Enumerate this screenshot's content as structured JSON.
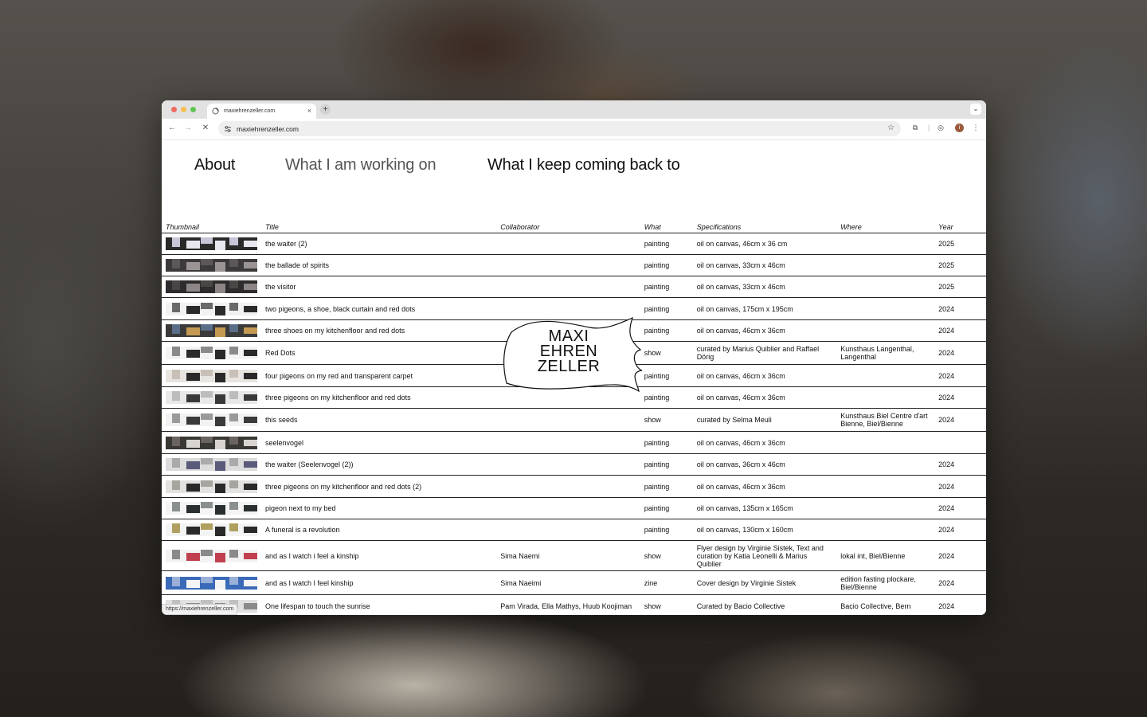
{
  "browser": {
    "tab_title": "maxiehrenzeller.com",
    "new_tab_label": "+",
    "tab_close_label": "×",
    "address": "maxiehrenzeller.com",
    "status_url": "https://maxiehrenzeller.com",
    "profile_initial": "i"
  },
  "nav": {
    "about": "About",
    "working_on": "What I am working on",
    "coming_back": "What I keep coming back to"
  },
  "logo": {
    "line1": "MAXI",
    "line2": "EHREN",
    "line3": "ZELLER"
  },
  "table": {
    "headers": [
      "Thumbnail",
      "Title",
      "Collaborator",
      "What",
      "Specifications",
      "Where",
      "Year"
    ],
    "rows": [
      {
        "title": "the waiter (2)",
        "collaborator": "",
        "what": "painting",
        "specs": "oil on canvas, 46cm x 36 cm",
        "where": "",
        "year": "2025"
      },
      {
        "title": "the ballade of spirits",
        "collaborator": "",
        "what": "painting",
        "specs": "oil on canvas, 33cm x 46cm",
        "where": "",
        "year": "2025"
      },
      {
        "title": "the visitor",
        "collaborator": "",
        "what": "painting",
        "specs": "oil on canvas, 33cm x 46cm",
        "where": "",
        "year": "2025"
      },
      {
        "title": "two pigeons, a shoe, black curtain and red dots",
        "collaborator": "",
        "what": "painting",
        "specs": "oil on canvas, 175cm x 195cm",
        "where": "",
        "year": "2024"
      },
      {
        "title": "three shoes on my kitchenfloor and red dots",
        "collaborator": "",
        "what": "painting",
        "specs": "oil on canvas, 46cm x 36cm",
        "where": "",
        "year": "2024"
      },
      {
        "title": "Red Dots",
        "collaborator": "",
        "what": "show",
        "specs": "curated by Marius Quiblier and Raffael Dörig",
        "where": "Kunsthaus Langenthal, Langenthal",
        "year": "2024"
      },
      {
        "title": "four pigeons on my red and transparent carpet",
        "collaborator": "",
        "what": "painting",
        "specs": "oil on canvas, 46cm x 36cm",
        "where": "",
        "year": "2024"
      },
      {
        "title": "three pigeons on my kitchenfloor and red dots",
        "collaborator": "",
        "what": "painting",
        "specs": "oil on canvas, 46cm x 36cm",
        "where": "",
        "year": "2024"
      },
      {
        "title": "this seeds",
        "collaborator": "",
        "what": "show",
        "specs": "curated by Selma Meuli",
        "where": "Kunsthaus Biel Centre d'art Bienne, Biel/Bienne",
        "year": "2024"
      },
      {
        "title": "seelenvogel",
        "collaborator": "",
        "what": "painting",
        "specs": "oil on canvas, 46cm x 36cm",
        "where": "",
        "year": ""
      },
      {
        "title": "the waiter (Seelenvogel (2))",
        "collaborator": "",
        "what": "painting",
        "specs": "oil on canvas, 36cm x 46cm",
        "where": "",
        "year": "2024"
      },
      {
        "title": "three pigeons on my kitchenfloor and red dots (2)",
        "collaborator": "",
        "what": "painting",
        "specs": "oil on canvas, 46cm x 36cm",
        "where": "",
        "year": "2024"
      },
      {
        "title": "pigeon next to my bed",
        "collaborator": "",
        "what": "painting",
        "specs": "oil on canvas, 135cm x 165cm",
        "where": "",
        "year": "2024"
      },
      {
        "title": "A funeral is a revolution",
        "collaborator": "",
        "what": "painting",
        "specs": "oil on canvas, 130cm x 160cm",
        "where": "",
        "year": "2024"
      },
      {
        "title": "and as I watch i feel a kinship",
        "collaborator": "Sima Naemi",
        "what": "show",
        "specs": "Flyer design by Virginie Sistek, Text and curation by Katia Leonelli & Marius Quiblier",
        "where": "lokal int, Biel/Bienne",
        "year": "2024"
      },
      {
        "title": "and as I watch I feel kinship",
        "collaborator": "Sima Naeimi",
        "what": "zine",
        "specs": "Cover design by Virginie Sistek",
        "where": "edition fasting plockare, Biel/Bienne",
        "year": "2024"
      },
      {
        "title": "One lifespan to touch the sunrise",
        "collaborator": "Pam Virada, Ella Mathys, Huub Koojiman",
        "what": "show",
        "specs": "Curated by Bacio Collective",
        "where": "Bacio Collective, Bern",
        "year": "2024"
      }
    ],
    "thumb_colors": [
      [
        "#2a2a2a",
        "#e8e6ef",
        "#c9c4d8"
      ],
      [
        "#3c3a3a",
        "#9a9494",
        "#5c5858"
      ],
      [
        "#2e2c2c",
        "#8c8686",
        "#4a4646"
      ],
      [
        "#f2f2f2",
        "#2a2a2a",
        "#6a6a6a"
      ],
      [
        "#3a3a3a",
        "#c49a52",
        "#5a6e8a"
      ],
      [
        "#f4f4f4",
        "#2a2a2a",
        "#8a8a8a"
      ],
      [
        "#e8e4e0",
        "#2a2a2a",
        "#c8c0b8"
      ],
      [
        "#e8e8e8",
        "#3a3a3a",
        "#bcbcbc"
      ],
      [
        "#f2f2f2",
        "#3a3a3a",
        "#9a9a9a"
      ],
      [
        "#3a3834",
        "#d8d4d0",
        "#6a6460"
      ],
      [
        "#dcdcdc",
        "#5a5a7a",
        "#aaaaaa"
      ],
      [
        "#e4e2e0",
        "#2a2a2a",
        "#a8a4a0"
      ],
      [
        "#f4f4f4",
        "#2a3030",
        "#8a9090"
      ],
      [
        "#f4f4f4",
        "#2a2a2a",
        "#b0a060"
      ],
      [
        "#f2f2f2",
        "#c04050",
        "#8a8a8a"
      ],
      [
        "#3a6ab8",
        "#f4f4f4",
        "#9ab0d8"
      ],
      [
        "#e0e0e0",
        "#8a8a8a",
        "#c0c0c0"
      ]
    ]
  }
}
